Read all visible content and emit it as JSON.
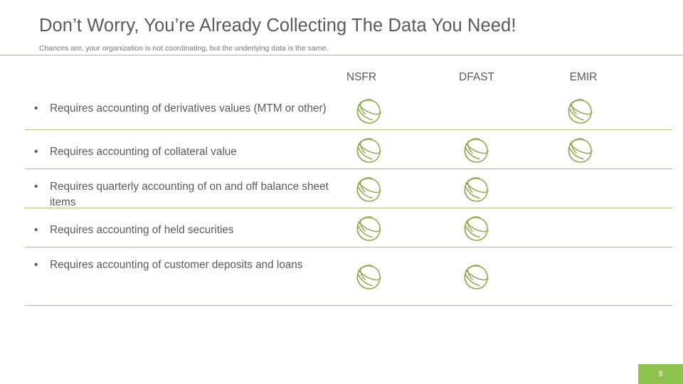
{
  "slide": {
    "title": "Don’t Worry, You’re Already Collecting The Data You Need!",
    "subtitle": "Chances are, your organization is not coordinating, but the underlying data is the same.",
    "page_number": "8"
  },
  "colors": {
    "accent_green": "#8dc24c",
    "rule_green": "#b5bf7a",
    "check_green": "#8faa4e",
    "text_gray": "#5a5a5a",
    "subtitle_gray": "#777777"
  },
  "matrix": {
    "bullet_glyph": "•",
    "check_icon": "sketch-circle-check-icon",
    "columns": [
      {
        "label": "NSFR"
      },
      {
        "label": "DFAST"
      },
      {
        "label": "EMIR"
      }
    ],
    "rows": [
      {
        "label": "Requires accounting of derivatives values (MTM or other)",
        "marks": [
          true,
          false,
          true
        ]
      },
      {
        "label": "Requires accounting of collateral value",
        "marks": [
          true,
          true,
          true
        ]
      },
      {
        "label": "Requires quarterly accounting of on and off balance sheet items",
        "marks": [
          true,
          true,
          false
        ]
      },
      {
        "label": "Requires accounting of held securities",
        "marks": [
          true,
          true,
          false
        ]
      },
      {
        "label": "Requires accounting of customer deposits and loans",
        "marks": [
          true,
          true,
          false
        ]
      }
    ]
  }
}
